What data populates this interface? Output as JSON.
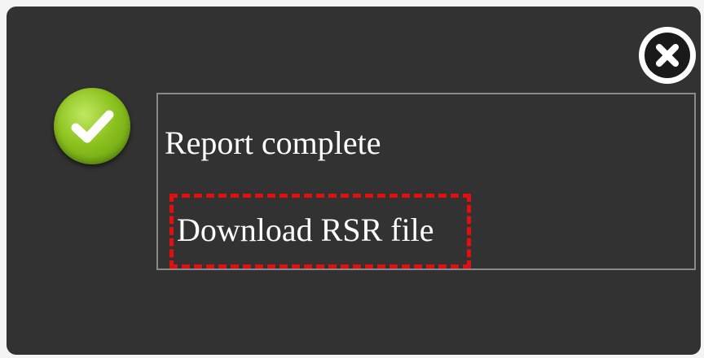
{
  "dialog": {
    "message": "Report complete",
    "download_link_label": "Download RSR file"
  },
  "icons": {
    "status": "check-circle-icon",
    "close": "close-icon"
  },
  "colors": {
    "dialog_background": "#323232",
    "success_green": "#8cc21e",
    "highlight_border": "#e01010",
    "text": "#ffffff"
  }
}
